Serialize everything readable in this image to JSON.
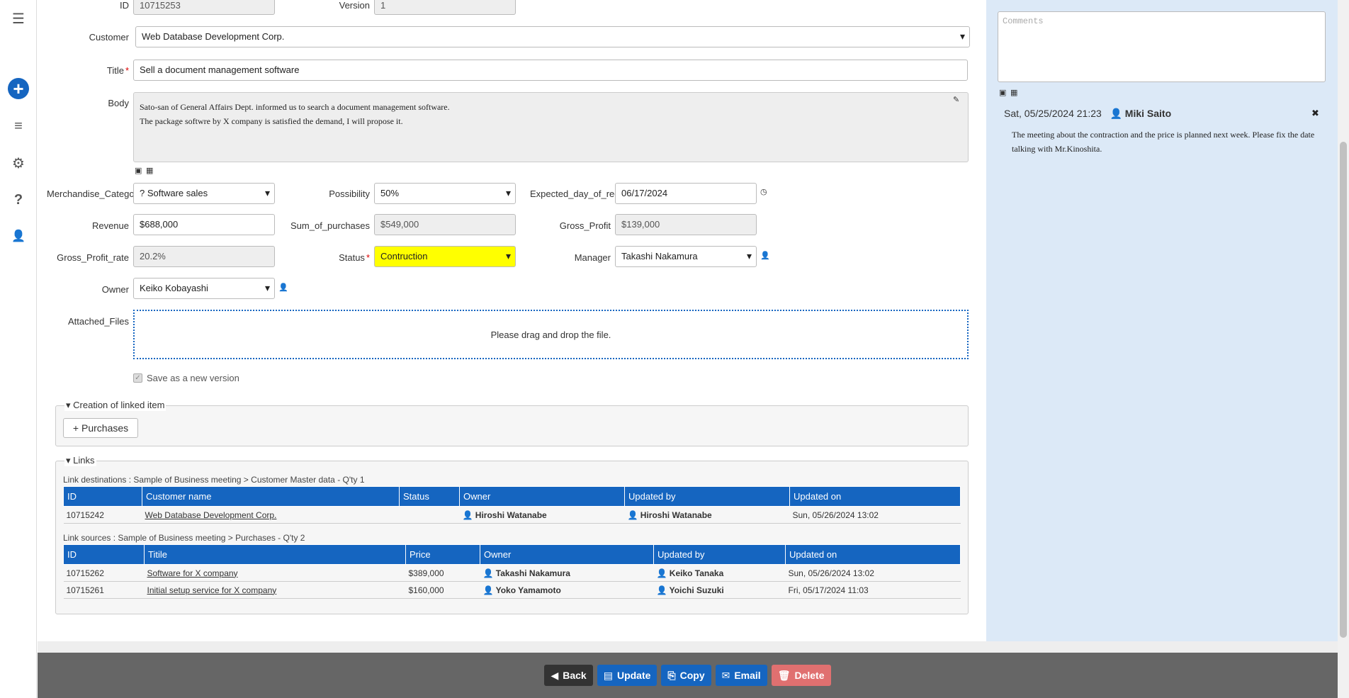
{
  "sidebar": {
    "menu_icon": "☰",
    "plus_icon": "+",
    "sort_icon": "≡",
    "gear_icon": "⚙",
    "help_icon": "?",
    "user_icon": "👤"
  },
  "form": {
    "id_label": "ID",
    "id_value": "10715253",
    "version_label": "Version",
    "version_value": "1",
    "customer_label": "Customer",
    "customer_value": "Web Database Development Corp.",
    "title_label": "Title",
    "title_value": "Sell a document management software",
    "body_label": "Body",
    "body_line1": "Sato-san of General Affairs Dept. informed us to search a document management software.",
    "body_line2": "The package softwre by X company is satisfied the demand, I will propose it.",
    "merch_label": "Merchandise_Catego",
    "merch_value": "? Software sales",
    "possibility_label": "Possibility",
    "possibility_value": "50%",
    "expected_label": "Expected_day_of_rec",
    "expected_value": "06/17/2024",
    "revenue_label": "Revenue",
    "revenue_value": "$688,000",
    "sum_label": "Sum_of_purchases",
    "sum_value": "$549,000",
    "gross_profit_label": "Gross_Profit",
    "gross_profit_value": "$139,000",
    "gross_rate_label": "Gross_Profit_rate",
    "gross_rate_value": "20.2%",
    "status_label": "Status",
    "status_value": "Contruction",
    "manager_label": "Manager",
    "manager_value": "Takashi Nakamura",
    "owner_label": "Owner",
    "owner_value": "Keiko Kobayashi",
    "attached_label": "Attached_Files",
    "drop_text": "Please drag and drop the file.",
    "save_version_label": "Save as a new version",
    "required_mark": "*"
  },
  "linked_item": {
    "legend": "Creation of linked item",
    "purchases_button": "Purchases"
  },
  "links": {
    "legend": "Links",
    "dest_caption": "Link destinations : Sample of Business meeting > Customer Master data - Q'ty 1",
    "dest_headers": [
      "ID",
      "Customer name",
      "Status",
      "Owner",
      "Updated by",
      "Updated on"
    ],
    "dest_rows": [
      {
        "id": "10715242",
        "name": "Web Database Development Corp.",
        "status": "",
        "owner": "Hiroshi Watanabe",
        "updated_by": "Hiroshi Watanabe",
        "updated_on": "Sun, 05/26/2024 13:02"
      }
    ],
    "src_caption": "Link sources : Sample of Business meeting > Purchases - Q'ty 2",
    "src_headers": [
      "ID",
      "Titile",
      "Price",
      "Owner",
      "Updated by",
      "Updated on"
    ],
    "src_rows": [
      {
        "id": "10715262",
        "title": "Software for X company",
        "price": "$389,000",
        "owner": "Takashi Nakamura",
        "updated_by": "Keiko Tanaka",
        "updated_on": "Sun, 05/26/2024 13:02"
      },
      {
        "id": "10715261",
        "title": "Initial setup service for X company",
        "price": "$160,000",
        "owner": "Yoko Yamamoto",
        "updated_by": "Yoichi Suzuki",
        "updated_on": "Fri, 05/17/2024 11:03"
      }
    ]
  },
  "comments": {
    "placeholder": "Comments",
    "date": "Sat, 05/25/2024 21:23",
    "author": "Miki Saito",
    "text": "The meeting about the contraction and the price is planned next week. Please fix the date talking with Mr.Kinoshita."
  },
  "footer": {
    "back": "Back",
    "update": "Update",
    "copy": "Copy",
    "email": "Email",
    "delete": "Delete"
  },
  "colors": {
    "accent": "#1565c0",
    "status_highlight": "#ffff00",
    "delete": "#e07070",
    "footer_bg": "#666666",
    "comment_panel": "#dce9f7"
  }
}
